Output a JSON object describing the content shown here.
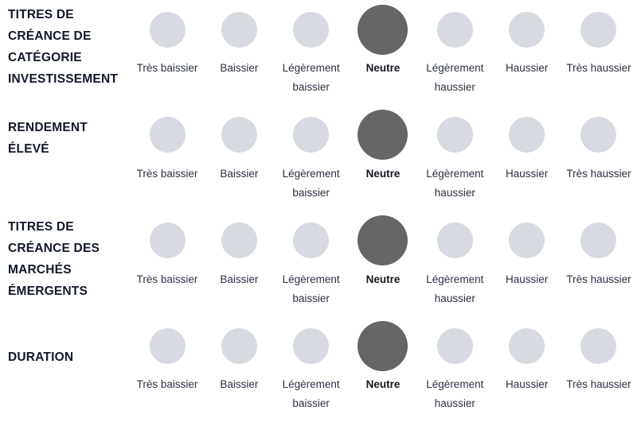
{
  "colors": {
    "dot_inactive": "#d7dae0",
    "dot_active": "#666666",
    "row_label_text": "#111827",
    "point_label_text": "#2c3140",
    "background": "#ffffff"
  },
  "scale": {
    "points": [
      {
        "label": "Très baissier"
      },
      {
        "label": "Baissier"
      },
      {
        "label": "Légèrement baissier"
      },
      {
        "label": "Neutre"
      },
      {
        "label": "Légèrement haussier"
      },
      {
        "label": "Haussier"
      },
      {
        "label": "Très haussier"
      }
    ]
  },
  "rows": [
    {
      "label": "TITRES DE CRÉANCE DE CATÉGORIE INVESTISSEMENT",
      "selected_index": 3,
      "points": [
        {
          "label": "Très baissier",
          "selected": false
        },
        {
          "label": "Baissier",
          "selected": false
        },
        {
          "label": "Légèrement baissier",
          "selected": false
        },
        {
          "label": "Neutre",
          "selected": true
        },
        {
          "label": "Légèrement haussier",
          "selected": false
        },
        {
          "label": "Haussier",
          "selected": false
        },
        {
          "label": "Très haussier",
          "selected": false
        }
      ]
    },
    {
      "label": "RENDEMENT ÉLEVÉ",
      "selected_index": 3,
      "points": [
        {
          "label": "Très baissier",
          "selected": false
        },
        {
          "label": "Baissier",
          "selected": false
        },
        {
          "label": "Légèrement baissier",
          "selected": false
        },
        {
          "label": "Neutre",
          "selected": true
        },
        {
          "label": "Légèrement haussier",
          "selected": false
        },
        {
          "label": "Haussier",
          "selected": false
        },
        {
          "label": "Très haussier",
          "selected": false
        }
      ]
    },
    {
      "label": "TITRES DE CRÉANCE DES MARCHÉS ÉMERGENTS",
      "selected_index": 3,
      "points": [
        {
          "label": "Très baissier",
          "selected": false
        },
        {
          "label": "Baissier",
          "selected": false
        },
        {
          "label": "Légèrement baissier",
          "selected": false
        },
        {
          "label": "Neutre",
          "selected": true
        },
        {
          "label": "Légèrement haussier",
          "selected": false
        },
        {
          "label": "Haussier",
          "selected": false
        },
        {
          "label": "Très haussier",
          "selected": false
        }
      ]
    },
    {
      "label": "DURATION",
      "selected_index": 3,
      "points": [
        {
          "label": "Très baissier",
          "selected": false
        },
        {
          "label": "Baissier",
          "selected": false
        },
        {
          "label": "Légèrement baissier",
          "selected": false
        },
        {
          "label": "Neutre",
          "selected": true
        },
        {
          "label": "Légèrement haussier",
          "selected": false
        },
        {
          "label": "Haussier",
          "selected": false
        },
        {
          "label": "Très haussier",
          "selected": false
        }
      ]
    }
  ]
}
